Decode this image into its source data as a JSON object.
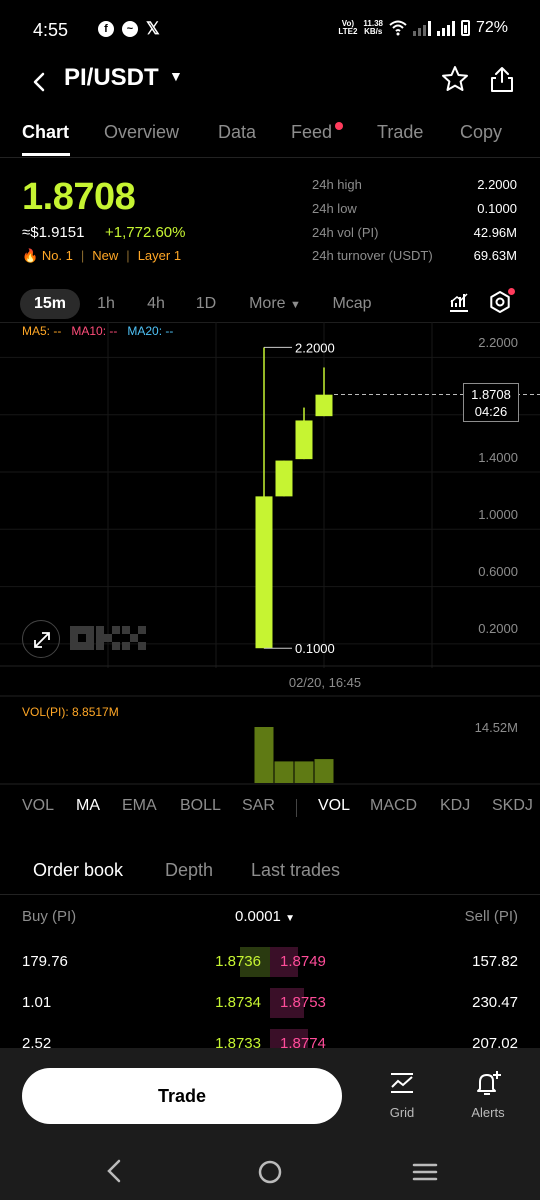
{
  "status_bar": {
    "time": "4:55",
    "net_top": "Vo) ",
    "net_bottom": "LTE2",
    "speed_top": "11.38",
    "speed_bottom": "KB/s",
    "battery": "72%",
    "icons": [
      "facebook-icon",
      "messenger-icon",
      "x-icon",
      "wifi-icon",
      "signal-icon",
      "battery-icon"
    ]
  },
  "header": {
    "pair": "PI/USDT"
  },
  "tabs": [
    "Chart",
    "Overview",
    "Data",
    "Feed",
    "Trade",
    "Copy"
  ],
  "active_tab": "Chart",
  "price": {
    "last": "1.8708",
    "usd": "≈$1.9151",
    "change": "+1,772.60%",
    "rank": "No. 1",
    "tag_new": "New",
    "tag_layer": "Layer 1"
  },
  "stats": [
    {
      "label": "24h high",
      "value": "2.2000"
    },
    {
      "label": "24h low",
      "value": "0.1000"
    },
    {
      "label": "24h vol (PI)",
      "value": "42.96M"
    },
    {
      "label": "24h turnover (USDT)",
      "value": "69.63M"
    }
  ],
  "intervals": {
    "i15m": "15m",
    "i1h": "1h",
    "i4h": "4h",
    "i1d": "1D",
    "more": "More",
    "mcap": "Mcap"
  },
  "ma_legend": {
    "ma5": "MA5: --",
    "ma10": "MA10: --",
    "ma20": "MA20: --"
  },
  "chart_data": {
    "type": "candlestick",
    "y_ticks": [
      "2.2000",
      "1.8000",
      "1.4000",
      "1.0000",
      "0.6000",
      "0.2000"
    ],
    "ylim": [
      0.1,
      2.2
    ],
    "candles": [
      {
        "open": 0.1,
        "close": 1.16,
        "high": 2.2,
        "low": 0.1
      },
      {
        "open": 1.16,
        "close": 1.41,
        "high": 1.41,
        "low": 1.16
      },
      {
        "open": 1.42,
        "close": 1.69,
        "high": 1.78,
        "low": 1.42
      },
      {
        "open": 1.72,
        "close": 1.87,
        "high": 2.06,
        "low": 1.72
      }
    ],
    "high_label": "2.2000",
    "low_label": "0.1000",
    "current_price": "1.8708",
    "countdown": "04:26",
    "date_label": "02/20, 16:45",
    "volume": {
      "label": "VOL(PI): 8.8517M",
      "max_label": "14.52M",
      "max": 14.52,
      "values": [
        14.52,
        5.6,
        5.6,
        6.2
      ]
    }
  },
  "indicators": {
    "main": [
      "VOL",
      "MA",
      "EMA",
      "BOLL",
      "SAR"
    ],
    "sub": [
      "VOL",
      "MACD",
      "KDJ",
      "SKDJ"
    ],
    "active_main": "MA",
    "active_sub": "VOL"
  },
  "order_book": {
    "tabs": [
      "Order book",
      "Depth",
      "Last trades"
    ],
    "buy_header": "Buy (PI)",
    "precision": "0.0001",
    "sell_header": "Sell (PI)",
    "rows": [
      {
        "buy_qty": "179.76",
        "bid": "1.8736",
        "ask": "1.8749",
        "sell_qty": "157.82"
      },
      {
        "buy_qty": "1.01",
        "bid": "1.8734",
        "ask": "1.8753",
        "sell_qty": "230.47"
      },
      {
        "buy_qty": "2.52",
        "bid": "1.8733",
        "ask": "1.8774",
        "sell_qty": "207.02"
      }
    ]
  },
  "bottom": {
    "trade": "Trade",
    "grid": "Grid",
    "alerts": "Alerts"
  },
  "colors": {
    "up": "#c6f432",
    "down": "#ff4d9a",
    "accent_orange": "#ffa726"
  }
}
